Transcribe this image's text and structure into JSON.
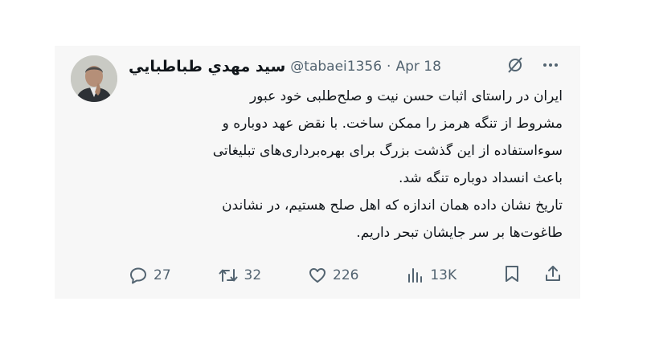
{
  "tweet": {
    "author_name": "سيد مهدي طباطبايي",
    "handle": "@tabaei1356",
    "separator": "·",
    "date": "Apr 18",
    "text": "ایران در راستای اثبات حسن نیت و صلح‌طلبی خود عبور\nمشروط از تنگه هرمز را ممکن ساخت.  با نقض عهد دوباره و\nسوءاستفاده از این گذشت بزرگ برای بهره‌برداری‌های تبلیغاتی\nباعث انسداد دوباره تنگه شد.\nتاریخ نشان داده همان اندازه که اهل صلح هستیم، در نشاندن\nطاغوت‌ها بر سر جایشان تبحر داریم."
  },
  "header_icons": [
    "grok-icon",
    "more-icon"
  ],
  "actions": {
    "replies": "27",
    "reposts": "32",
    "likes": "226",
    "views": "13K"
  },
  "colors": {
    "text": "#0f1419",
    "muted": "#536471",
    "card_bg": "#f7f7f7"
  }
}
